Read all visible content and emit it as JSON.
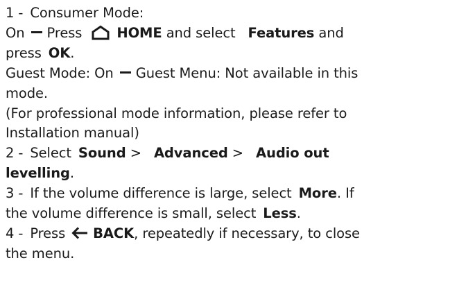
{
  "step1": {
    "num": "1 -",
    "title": "Consumer Mode:",
    "line2a": "On",
    "line2b": "Press",
    "home_label": "HOME",
    "line2c": "and select",
    "features_label": "Features",
    "line2d": "and",
    "line3a": "press",
    "ok_label": "OK",
    "guest_line_a": "Guest Mode: On",
    "guest_line_b": "Guest Menu: Not available in this",
    "guest_line_c": "mode.",
    "professional_line_a": "(For professional mode information, please refer to",
    "professional_line_b": "Installation manual)"
  },
  "step2": {
    "num": "2 -",
    "select": "Select",
    "sound": "Sound",
    "advanced": "Advanced",
    "audio_out_a": "Audio out",
    "audio_out_b": "levelling"
  },
  "step3": {
    "num": "3 -",
    "line_a": "If the volume difference is large, select",
    "more": "More",
    "line_a_end": "If",
    "line_b": "the volume difference is small, select",
    "less": "Less"
  },
  "step4": {
    "num": "4 -",
    "press": "Press",
    "back_label": "BACK",
    "line_a_end": ", repeatedly if necessary, to close",
    "line_b": "the menu."
  },
  "icons": {
    "home": "home-icon",
    "back": "back-arrow-icon"
  }
}
